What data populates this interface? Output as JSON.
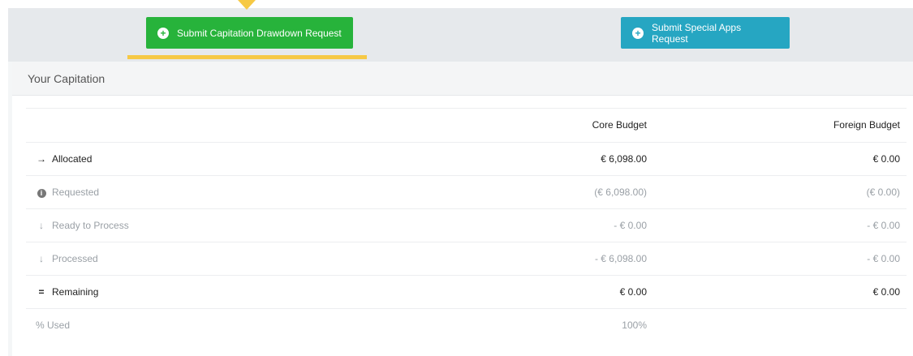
{
  "actions": {
    "drawdown_label": "Submit Capitation Drawdown Request",
    "special_label": "Submit Special Apps Request"
  },
  "panel": {
    "title": "Your Capitation"
  },
  "table": {
    "headers": {
      "core": "Core Budget",
      "foreign": "Foreign Budget"
    },
    "rows": [
      {
        "icon": "arrow-right-icon",
        "label": "Allocated",
        "core": "€ 6,098.00",
        "foreign": "€ 0.00",
        "style": "bold"
      },
      {
        "icon": "info-icon",
        "label": "Requested",
        "core": "(€ 6,098.00)",
        "foreign": "(€ 0.00)",
        "style": "muted"
      },
      {
        "icon": "arrow-down-icon",
        "label": "Ready to Process",
        "core": "- € 0.00",
        "foreign": "- € 0.00",
        "style": "muted"
      },
      {
        "icon": "arrow-down-icon",
        "label": "Processed",
        "core": "- € 6,098.00",
        "foreign": "- € 0.00",
        "style": "muted"
      },
      {
        "icon": "equals-icon",
        "label": "Remaining",
        "core": "€ 0.00",
        "foreign": "€ 0.00",
        "style": "bold"
      },
      {
        "icon": "",
        "label": "% Used",
        "core": "100%",
        "foreign": "",
        "style": "muted"
      }
    ]
  },
  "colors": {
    "green": "#27b33b",
    "teal": "#26a6c2",
    "highlight": "#f6c945"
  }
}
